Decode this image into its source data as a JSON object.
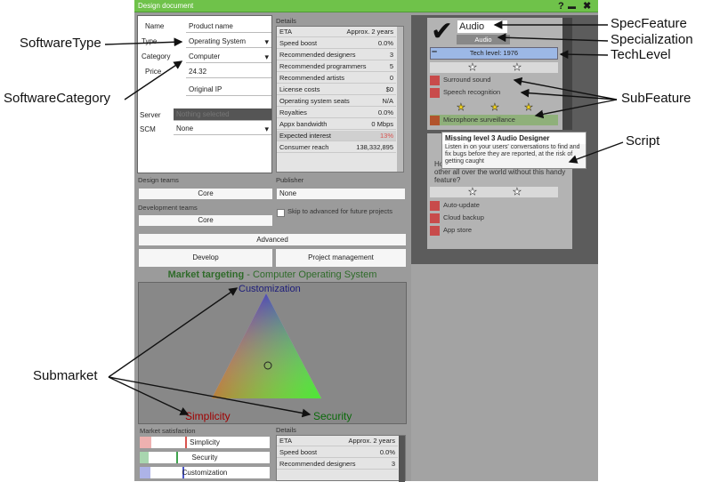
{
  "window": {
    "title": "Design document",
    "help": "?",
    "minimize": "▬",
    "close": "✖"
  },
  "form": {
    "name_label": "Name",
    "name_value": "Product name",
    "type_label": "Type",
    "type_value": "Operating System",
    "category_label": "Category",
    "category_value": "Computer",
    "price_label": "Price",
    "price_value": "24.32",
    "ip_value": "Original IP",
    "server_label": "Server",
    "server_placeholder": "Nothing selected",
    "scm_label": "SCM",
    "scm_value": "None"
  },
  "details": {
    "title": "Details",
    "rows": [
      {
        "label": "ETA",
        "value": "Approx. 2 years"
      },
      {
        "label": "Speed boost",
        "value": "0.0%"
      },
      {
        "label": "Recommended designers",
        "value": "3"
      },
      {
        "label": "Recommended programmers",
        "value": "5"
      },
      {
        "label": "Recommended artists",
        "value": "0"
      },
      {
        "label": "License costs",
        "value": "$0"
      },
      {
        "label": "Operating system seats",
        "value": "N/A"
      },
      {
        "label": "Royalties",
        "value": "0.0%"
      },
      {
        "label": "Appx bandwidth",
        "value": "0 Mbps"
      },
      {
        "label": "Expected interest",
        "value": "13%"
      },
      {
        "label": "Consumer reach",
        "value": "138,332,895"
      }
    ]
  },
  "teams": {
    "design_label": "Design teams",
    "design_value": "Core",
    "dev_label": "Development teams",
    "dev_value": "Core",
    "publisher_label": "Publisher",
    "publisher_value": "None",
    "skip_label": "Skip to advanced for future projects"
  },
  "buttons": {
    "advanced": "Advanced",
    "develop": "Develop",
    "pm": "Project management"
  },
  "market": {
    "title_a": "Market targeting",
    "title_b": " - Computer Operating System",
    "top": "Customization",
    "left": "Simplicity",
    "right": "Security",
    "satisfaction_label": "Market satisfaction",
    "bars": [
      {
        "label": "Simplicity",
        "color": "#d9534f",
        "fill": 0.35
      },
      {
        "label": "Security",
        "color": "#3fa34d",
        "fill": 0.28
      },
      {
        "label": "Customization",
        "color": "#4a56c9",
        "fill": 0.33
      }
    ]
  },
  "details2": {
    "title": "Details",
    "rows": [
      {
        "label": "ETA",
        "value": "Approx. 2 years"
      },
      {
        "label": "Speed boost",
        "value": "0.0%"
      },
      {
        "label": "Recommended designers",
        "value": "3"
      }
    ]
  },
  "feature": {
    "name": "Audio",
    "specialization": "Audio",
    "tech_level": "Tech level: 1976",
    "sub1": [
      "Surround sound",
      "Speech recognition",
      "Microphone surveillance"
    ],
    "tooltip_title": "Missing level 3 Audio Designer",
    "tooltip_body": "Listen in on your users' conversations to find and fix bugs before they are reported, at the risk of getting caught",
    "question": "How will anonymous people troll each other all over the world without this handy feature?",
    "sub2": [
      "Auto-update",
      "Cloud backup",
      "App store"
    ]
  },
  "annotations": {
    "spec_feature": "SpecFeature",
    "specialization": "Specialization",
    "tech_level": "TechLevel",
    "software_type": "SoftwareType",
    "software_category": "SoftwareCategory",
    "sub_feature": "SubFeature",
    "script": "Script",
    "submarket": "Submarket"
  }
}
